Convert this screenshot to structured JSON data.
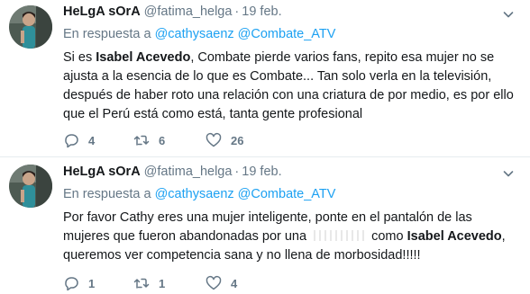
{
  "tweets": [
    {
      "author_name": "HeLgA sOrA",
      "handle": "@fatima_helga",
      "separator": "·",
      "date": "19 feb.",
      "reply_prefix": "En respuesta a",
      "reply_to": "@cathysaenz @Combate_ATV",
      "text_part1": "Si es ",
      "text_bold1": "Isabel Acevedo",
      "text_part2": ", Combate pierde varios fans, repito esa mujer no se ajusta a la esencia de lo que es Combate... Tan solo verla en la televisión, después de haber roto una relación con una criatura de por medio, es por ello que el Perú está como está, tanta gente profesional",
      "replies": "4",
      "retweets": "6",
      "likes": "26",
      "icons": [
        "chevron-down-icon",
        "reply-icon",
        "retweet-icon",
        "heart-icon"
      ]
    },
    {
      "author_name": "HeLgA sOrA",
      "handle": "@fatima_helga",
      "separator": "·",
      "date": "19 feb.",
      "reply_prefix": "En respuesta a",
      "reply_to": "@cathysaenz @Combate_ATV",
      "text_part1": "Por favor Cathy eres una mujer inteligente, ponte en el pantalón de las mujeres que fueron abandonadas por una ",
      "text_part2": " como ",
      "text_bold1": "Isabel Acevedo",
      "text_part3": ", queremos ver competencia sana y no llena de morbosidad!!!!!",
      "replies": "1",
      "retweets": "1",
      "likes": "4",
      "icons": [
        "chevron-down-icon",
        "reply-icon",
        "retweet-icon",
        "heart-icon"
      ]
    }
  ],
  "colors": {
    "link": "#1da1f2",
    "muted": "#657786",
    "text": "#14171a",
    "divider": "#e6ecf0"
  }
}
